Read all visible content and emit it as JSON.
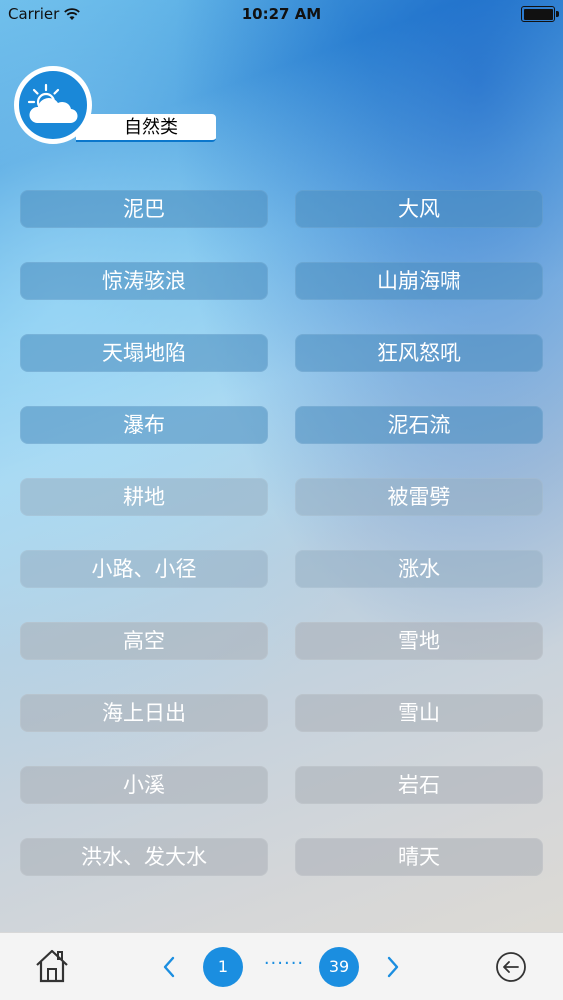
{
  "status_bar": {
    "carrier": "Carrier",
    "time": "10:27 AM"
  },
  "category": {
    "title": "自然类",
    "icon": "cloud-sun-icon"
  },
  "items": [
    "泥巴",
    "大风",
    "惊涛骇浪",
    "山崩海啸",
    "天塌地陷",
    "狂风怒吼",
    "瀑布",
    "泥石流",
    "耕地",
    "被雷劈",
    "小路、小径",
    "涨水",
    "高空",
    "雪地",
    "海上日出",
    "雪山",
    "小溪",
    "岩石",
    "洪水、发大水",
    "晴天"
  ],
  "pagination": {
    "current": "1",
    "ellipsis": "······",
    "last": "39"
  },
  "colors": {
    "accent": "#1b8ee0",
    "bottom_bar": "#f4f4f4"
  }
}
